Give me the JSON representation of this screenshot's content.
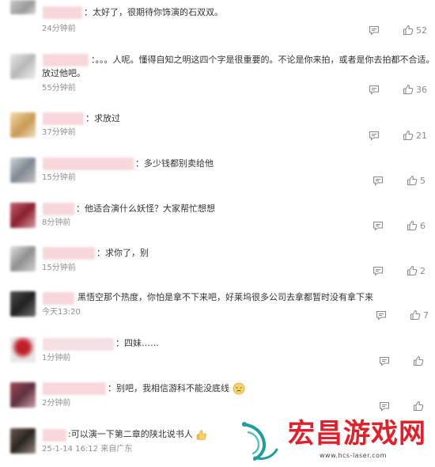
{
  "comments": [
    {
      "text": "：太好了，很期待你饰演的石双双。",
      "time": "24分钟前",
      "likes": "52"
    },
    {
      "text": "：。。。人呢。懂得自知之明这四个字是很重要的。不论是你来拍，或者是你去拍都不合适。",
      "text2": "放过他吧。",
      "time": "55分钟前",
      "likes": "36"
    },
    {
      "text": "：求放过",
      "time": "37分钟前",
      "likes": "21"
    },
    {
      "text": "：多少钱都别卖给他",
      "time": "15分钟前",
      "likes": "5"
    },
    {
      "text": "：他适合演什么妖怪？大家帮忙想想",
      "time": "8分钟前",
      "likes": "6"
    },
    {
      "text": "：求你了，别",
      "time": "15分钟前",
      "likes": "2"
    },
    {
      "text": "黑悟空那个热度，你怕是拿不下来吧，好莱坞很多公司去拿都暂时没有拿下来",
      "time": "今天13:20",
      "likes": "7"
    },
    {
      "text": "：四妹……",
      "time": "1分钟前",
      "likes": ""
    },
    {
      "text": "：别吧，我相信游科不能没底线",
      "time": "2分钟前",
      "likes": ""
    },
    {
      "text": ":可以演一下第二章的陕北说书人",
      "time": "25-1-14 16:12 来自广东",
      "likes": ""
    }
  ],
  "watermark": {
    "brand": "宏昌游戏网",
    "url": "www.hcs-laser.com"
  },
  "colors": {
    "like": "#8a8a8a",
    "brand_red": "#e0202a",
    "brand_teal": "#1f9d9a"
  }
}
